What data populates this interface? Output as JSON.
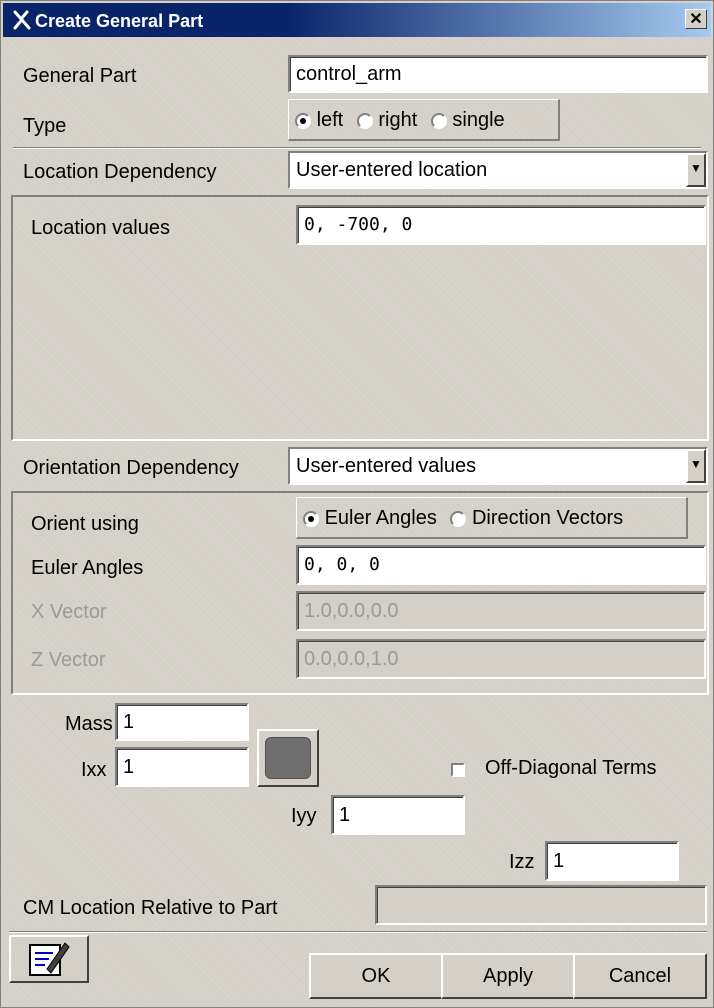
{
  "window": {
    "title": "Create General Part",
    "close_glyph": "✕"
  },
  "form": {
    "general_part_label": "General Part",
    "general_part_value": "control_arm",
    "type_label": "Type",
    "type_options": [
      "left",
      "right",
      "single"
    ],
    "type_selected": "left",
    "location_dependency_label": "Location Dependency",
    "location_dependency_value": "User-entered location",
    "location_values_label": "Location values",
    "location_values_value": "0, -700, 0",
    "orientation_dependency_label": "Orientation Dependency",
    "orientation_dependency_value": "User-entered values",
    "orient_using_label": "Orient using",
    "orient_options": [
      "Euler Angles",
      "Direction Vectors"
    ],
    "orient_selected": "Euler Angles",
    "euler_angles_label": "Euler Angles",
    "euler_angles_value": "0, 0, 0",
    "x_vector_label": "X Vector",
    "x_vector_value": "1.0,0.0,0.0",
    "z_vector_label": "Z Vector",
    "z_vector_value": "0.0,0.0,1.0",
    "mass_label": "Mass",
    "mass_value": "1",
    "ixx_label": "Ixx",
    "ixx_value": "1",
    "iyy_label": "Iyy",
    "iyy_value": "1",
    "izz_label": "Izz",
    "izz_value": "1",
    "off_diagonal_label": "Off-Diagonal Terms",
    "off_diagonal_checked": false,
    "cm_location_label": "CM Location Relative to Part",
    "cm_location_value": ""
  },
  "buttons": {
    "ok": "OK",
    "apply": "Apply",
    "cancel": "Cancel"
  },
  "icons": {
    "title": "adams-x-icon",
    "notes": "edit-notes-icon",
    "color": "part-color-swatch"
  },
  "colors": {
    "titlebar": "#0a246a",
    "dialog_bg": "#d4d0c8"
  }
}
